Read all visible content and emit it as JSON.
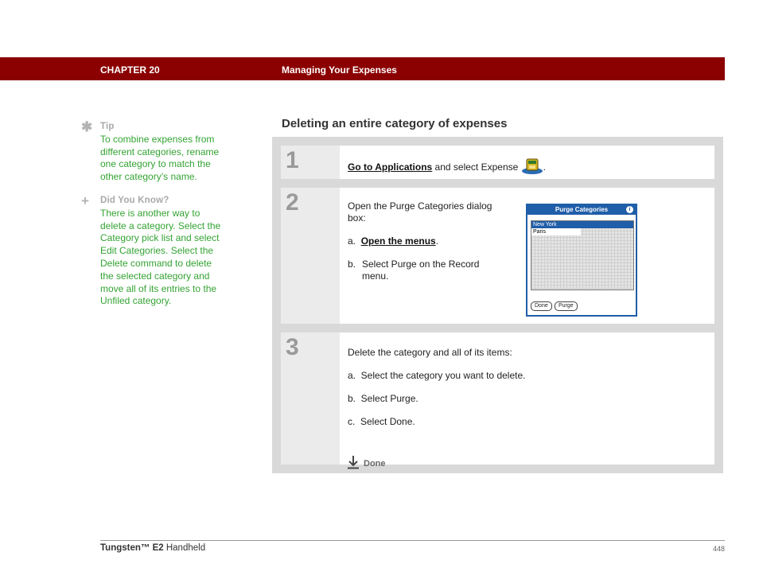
{
  "header": {
    "chapter": "CHAPTER 20",
    "title": "Managing Your Expenses"
  },
  "sidebar": {
    "tip": {
      "icon": "asterisk-icon",
      "heading": "Tip",
      "text": "To combine expenses from different categories, rename one category to match the other category’s name."
    },
    "did_you_know": {
      "icon": "plus-icon",
      "heading": "Did You Know?",
      "text": "There is another way to delete a category. Select the Category pick list and select Edit Categories. Select the Delete command to delete the selected category and move all of its entries to the Unfiled category."
    }
  },
  "section_title": "Deleting an entire category of expenses",
  "steps": {
    "step1": {
      "number": "1",
      "link": "Go to Applications",
      "text": " and select Expense ",
      "icon": "expense-app-icon",
      "end": "."
    },
    "step2": {
      "number": "2",
      "intro": "Open the Purge Categories dialog box:",
      "a_marker": "a.",
      "a_link": "Open the menus",
      "a_end": ".",
      "b_marker": "b.",
      "b_text": "Select Purge on the Record menu.",
      "dialog": {
        "title": "Purge Categories",
        "info": "i",
        "items": [
          "New York",
          "Paris"
        ],
        "buttons": [
          "Done",
          "Purge"
        ]
      }
    },
    "step3": {
      "number": "3",
      "intro": "Delete the category and all of its items:",
      "a": "a.  Select the category you want to delete.",
      "b": "b.  Select Purge.",
      "c": "c.  Select Done.",
      "done": "Done"
    }
  },
  "footer": {
    "product_bold": "Tungsten™ E2",
    "product_rest": " Handheld",
    "page": "448"
  },
  "colors": {
    "header_bar": "#8b0000",
    "sidebar_text": "#33a333",
    "dialog_blue": "#1f5ea8"
  }
}
